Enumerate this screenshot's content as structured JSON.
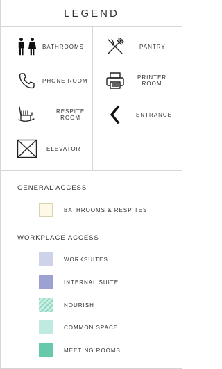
{
  "legend": {
    "title": "LEGEND",
    "icons": [
      {
        "name": "bathrooms",
        "label": "BATHROOMS",
        "icon": "restroom-icon"
      },
      {
        "name": "pantry",
        "label": "PANTRY",
        "icon": "fork-knife-icon"
      },
      {
        "name": "phone-room",
        "label": "PHONE ROOM",
        "icon": "phone-icon"
      },
      {
        "name": "printer-room",
        "label_line1": "PRINTER",
        "label_line2": "ROOM",
        "icon": "printer-icon"
      },
      {
        "name": "respite-room",
        "label_line1": "RESPITE",
        "label_line2": "ROOM",
        "icon": "rocking-chair-icon"
      },
      {
        "name": "entrance",
        "label": "ENTRANCE",
        "icon": "chevron-left-icon"
      },
      {
        "name": "elevator",
        "label": "ELEVATOR",
        "icon": "elevator-icon"
      }
    ]
  },
  "general_access": {
    "title": "GENERAL ACCESS",
    "items": [
      {
        "label": "BATHROOMS & RESPITES",
        "color": "#fdf9e6",
        "border": "#d9d3b4"
      }
    ]
  },
  "workplace_access": {
    "title": "WORKPLACE ACCESS",
    "items": [
      {
        "label": "WORKSUITES",
        "color": "#cfd3ea"
      },
      {
        "label": "INTERNAL SUITE",
        "color": "#9ba2d2"
      },
      {
        "label": "NOURISH",
        "color": "#9fddcb",
        "pattern": "diagonal-hatch"
      },
      {
        "label": "COMMON SPACE",
        "color": "#bfeadf"
      },
      {
        "label": "MEETING ROOMS",
        "color": "#66c9ab"
      }
    ]
  }
}
